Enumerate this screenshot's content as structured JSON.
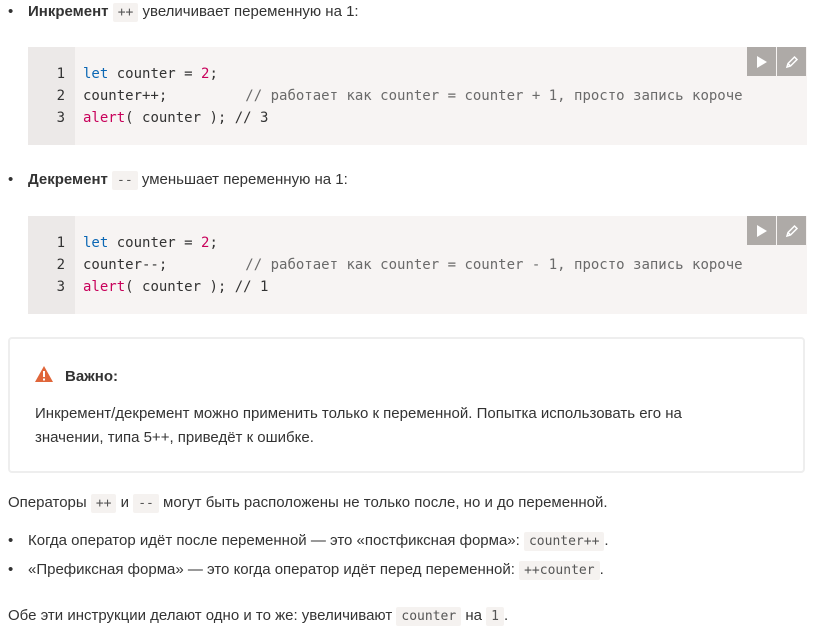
{
  "increment": {
    "bullet": "•",
    "term": "Инкремент",
    "op": "++",
    "desc": "увеличивает переменную на 1:",
    "lines": [
      {
        "num": "1",
        "kw": "let",
        "mid": " counter = ",
        "val": "2",
        "end": ";"
      },
      {
        "num": "2",
        "code": "counter++;",
        "comment": "// работает как counter = counter + 1, просто запись короче"
      },
      {
        "num": "3",
        "fn": "alert",
        "rest": "( counter ); // 3"
      }
    ]
  },
  "decrement": {
    "bullet": "•",
    "term": "Декремент",
    "op": "--",
    "desc": "уменьшает переменную на 1:",
    "lines": [
      {
        "num": "1",
        "kw": "let",
        "mid": " counter = ",
        "val": "2",
        "end": ";"
      },
      {
        "num": "2",
        "code": "counter--;",
        "comment": "// работает как counter = counter - 1, просто запись короче"
      },
      {
        "num": "3",
        "fn": "alert",
        "rest": "( counter ); // 1"
      }
    ]
  },
  "warning": {
    "title": "Важно:",
    "text_line1": "Инкремент/декремент можно применить только к переменной. Попытка использовать его на",
    "text_line2": "значении, типа 5++, приведёт к ошибке.",
    "icon_color": "#e0663a"
  },
  "operators_para": {
    "before": "Операторы",
    "op1": "++",
    "and": "и",
    "op2": "--",
    "after": "могут быть расположены не только после, но и до переменной."
  },
  "forms": [
    {
      "bullet": "•",
      "text": "Когда оператор идёт после переменной — это «постфиксная форма»:",
      "code": "counter++",
      "end": "."
    },
    {
      "bullet": "•",
      "text": "«Префиксная форма» — это когда оператор идёт перед переменной:",
      "code": "++counter",
      "end": "."
    }
  ],
  "final_para": {
    "before": "Обе эти инструкции делают одно и то же: увеличивают",
    "code": "counter",
    "mid": "на",
    "num": "1",
    "end": "."
  },
  "buttons": {
    "run_icon": "play-icon",
    "edit_icon": "pencil-icon"
  },
  "colors": {
    "keyword": "#0b67b4",
    "number": "#c8005a",
    "comment": "#6a6a6a",
    "button_bg": "#aeaaa7"
  }
}
